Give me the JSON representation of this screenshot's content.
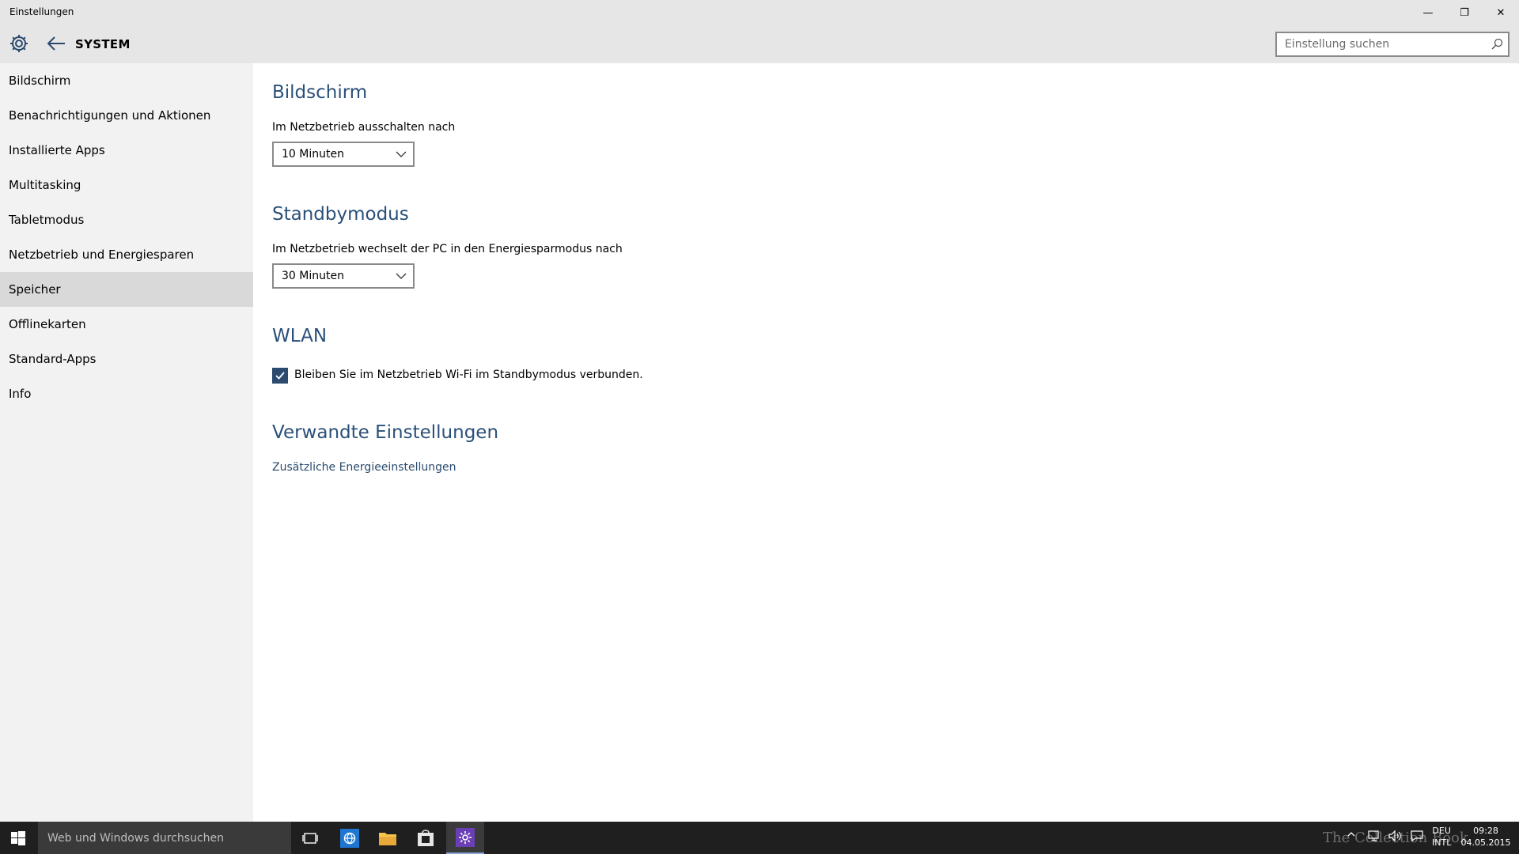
{
  "window": {
    "title": "Einstellungen",
    "controls": {
      "minimize": "—",
      "maximize": "❐",
      "close": "✕"
    }
  },
  "header": {
    "section": "SYSTEM",
    "search_placeholder": "Einstellung suchen"
  },
  "sidebar": {
    "items": [
      {
        "label": "Bildschirm",
        "selected": false
      },
      {
        "label": "Benachrichtigungen und Aktionen",
        "selected": false
      },
      {
        "label": "Installierte Apps",
        "selected": false
      },
      {
        "label": "Multitasking",
        "selected": false
      },
      {
        "label": "Tabletmodus",
        "selected": false
      },
      {
        "label": "Netzbetrieb und Energiesparen",
        "selected": false
      },
      {
        "label": "Speicher",
        "selected": true
      },
      {
        "label": "Offlinekarten",
        "selected": false
      },
      {
        "label": "Standard-Apps",
        "selected": false
      },
      {
        "label": "Info",
        "selected": false
      }
    ]
  },
  "main": {
    "screen": {
      "heading": "Bildschirm",
      "label": "Im Netzbetrieb ausschalten nach",
      "value": "10 Minuten"
    },
    "standby": {
      "heading": "Standbymodus",
      "label": "Im Netzbetrieb wechselt der PC in den Energiesparmodus nach",
      "value": "30 Minuten"
    },
    "wlan": {
      "heading": "WLAN",
      "checkbox_label": "Bleiben Sie im Netzbetrieb Wi-Fi im Standbymodus verbunden.",
      "checked": true
    },
    "related": {
      "heading": "Verwandte Einstellungen",
      "link": "Zusätzliche Energieeinstellungen"
    }
  },
  "taskbar": {
    "search_placeholder": "Web und Windows durchsuchen",
    "tray": {
      "lang_top": "DEU",
      "lang_bottom": "INTL",
      "time": "09:28",
      "date": "04.05.2015"
    },
    "watermark": "The Collection Book"
  },
  "colors": {
    "accent": "#2b4a6e",
    "heading": "#2a5079",
    "sidebar_bg": "#f2f2f2",
    "sidebar_selected": "#d9d9d9",
    "titlebar_bg": "#e6e6e6",
    "taskbar_bg": "#1f1f1f"
  }
}
